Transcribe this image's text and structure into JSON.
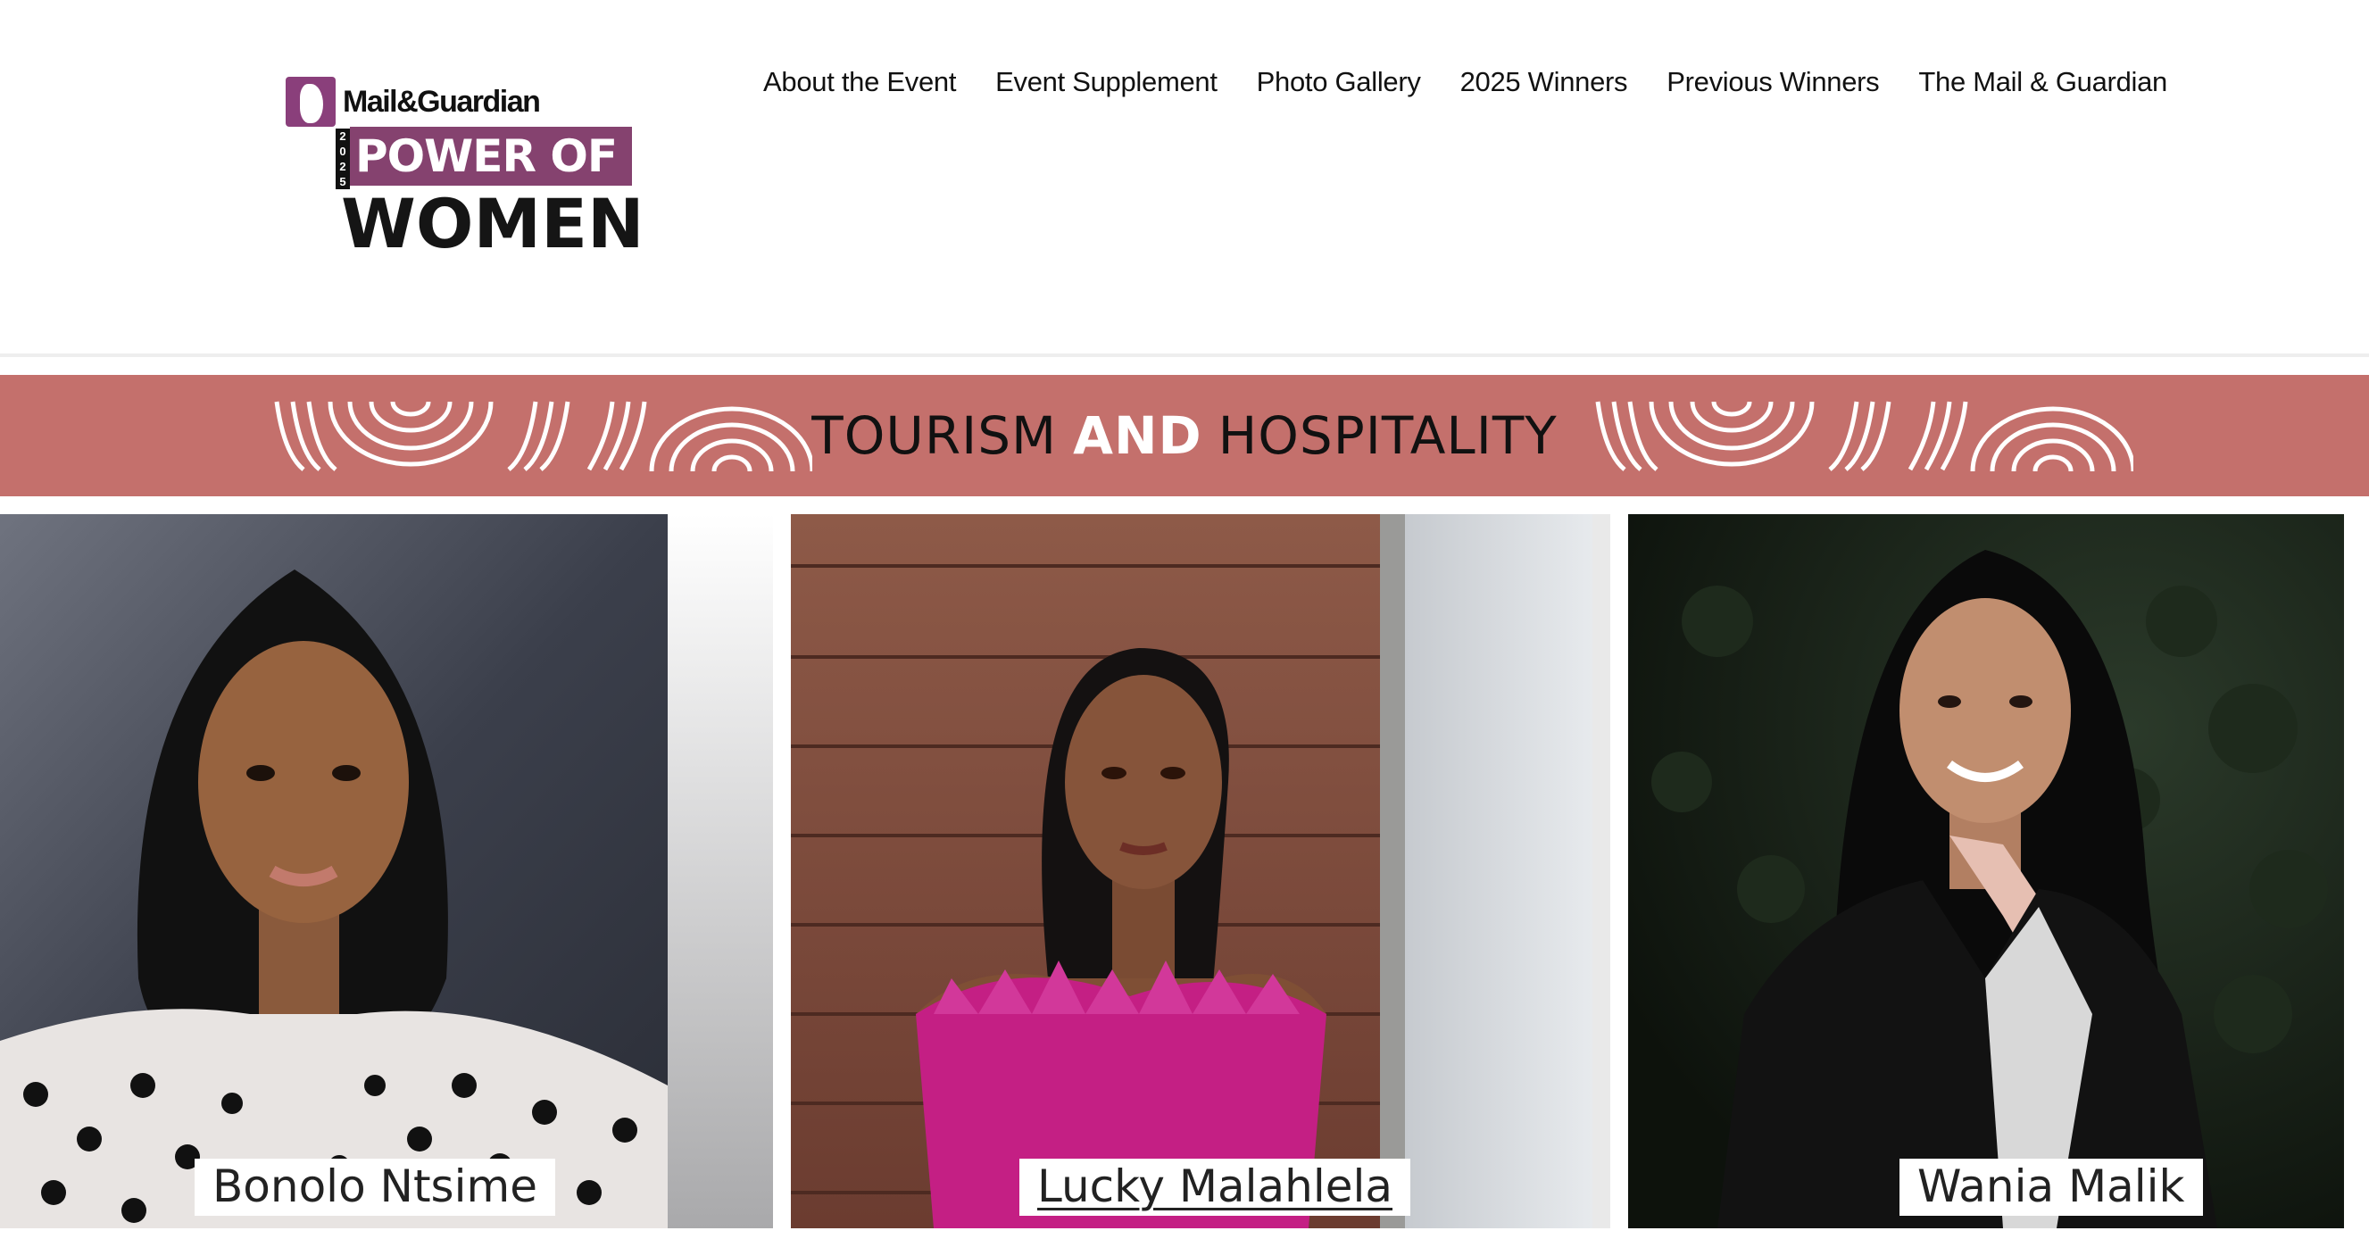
{
  "logo": {
    "masthead": "Mail&Guardian",
    "year_digits": [
      "2",
      "0",
      "2",
      "5"
    ],
    "line1": "POWER OF",
    "line2": "WOMEN"
  },
  "nav": {
    "items": [
      {
        "label": "About the Event"
      },
      {
        "label": "Event Supplement"
      },
      {
        "label": "Photo Gallery"
      },
      {
        "label": "2025 Winners"
      },
      {
        "label": "Previous Winners"
      },
      {
        "label": "The Mail & Guardian"
      }
    ]
  },
  "banner": {
    "word1": "TOURISM",
    "word2": "AND",
    "word3": "HOSPITALITY",
    "color": "#c4706c"
  },
  "winners": [
    {
      "name": "Bonolo Ntsime"
    },
    {
      "name": "Lucky Malahlela"
    },
    {
      "name": "Wania Malik"
    }
  ],
  "colors": {
    "brand_purple": "#85426f",
    "banner_rose": "#c4706c",
    "text": "#111111"
  }
}
